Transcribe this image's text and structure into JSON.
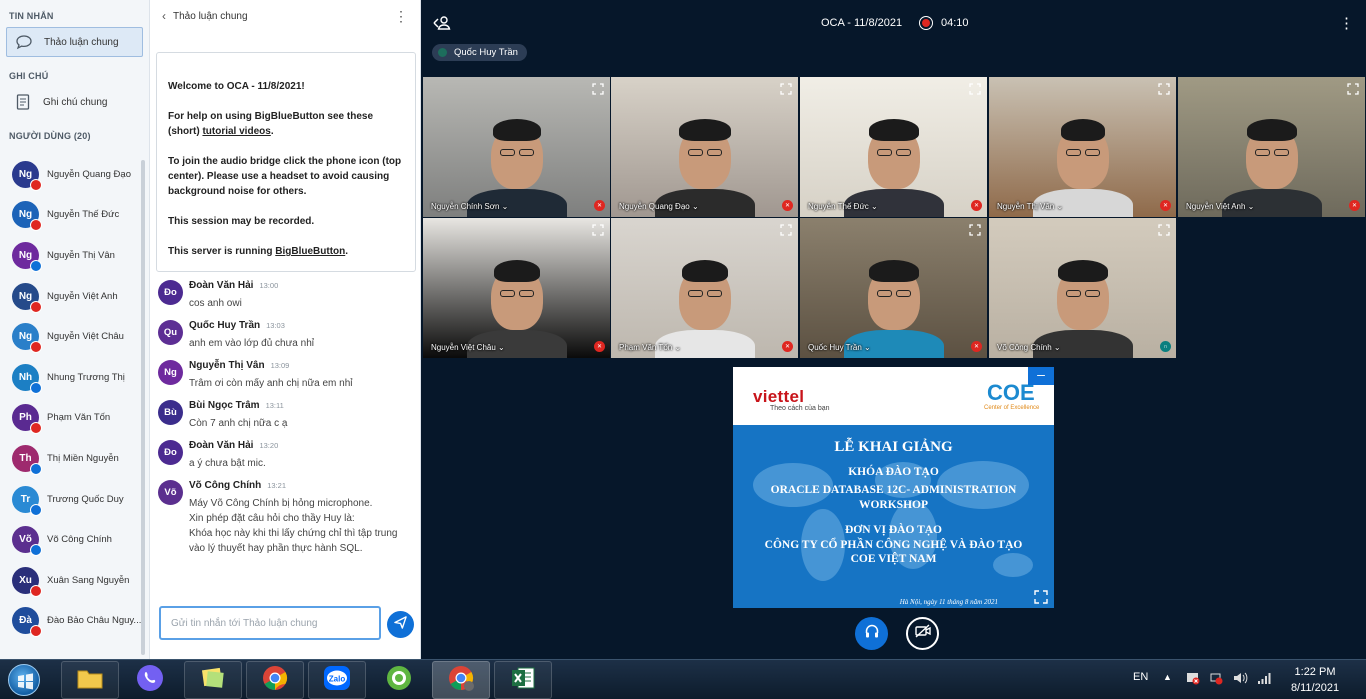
{
  "sidebar": {
    "messages_title": "TIN NHẮN",
    "public_chat": "Thảo luận chung",
    "notes_title": "GHI CHÚ",
    "shared_notes": "Ghi chú chung",
    "users_title": "NGƯỜI DÙNG (20)",
    "users": [
      {
        "initials": "Ng",
        "name": "Nguyễn Quang Đạo",
        "color": "#2a3a8e",
        "status": "muted"
      },
      {
        "initials": "Ng",
        "name": "Nguyễn Thế Đức",
        "color": "#1c63b8",
        "status": "muted"
      },
      {
        "initials": "Ng",
        "name": "Nguyễn Thị Vân",
        "color": "#6e2a9e",
        "status": "listen"
      },
      {
        "initials": "Ng",
        "name": "Nguyễn Việt Anh",
        "color": "#254a8a",
        "status": "muted"
      },
      {
        "initials": "Ng",
        "name": "Nguyễn Việt Châu",
        "color": "#2a7fc9",
        "status": "muted"
      },
      {
        "initials": "Nh",
        "name": "Nhung Trương Thị",
        "color": "#1c7fc4",
        "status": "listen"
      },
      {
        "initials": "Ph",
        "name": "Phạm Văn Tốn",
        "color": "#5a2a91",
        "status": "muted"
      },
      {
        "initials": "Th",
        "name": "Thị Miền Nguyễn",
        "color": "#9e2a6e",
        "status": "listen"
      },
      {
        "initials": "Tr",
        "name": "Trương Quốc Duy",
        "color": "#2a8ad4",
        "status": "listen"
      },
      {
        "initials": "Võ",
        "name": "Võ Công Chính",
        "color": "#5b2f8f",
        "status": "listen"
      },
      {
        "initials": "Xu",
        "name": "Xuân Sang Nguyễn",
        "color": "#2a2f7a",
        "status": "muted"
      },
      {
        "initials": "Đà",
        "name": "Đào Bảo Châu Nguy...",
        "color": "#1f4d9c",
        "status": "muted"
      }
    ]
  },
  "chat": {
    "title": "Thảo luận chung",
    "welcome": {
      "l1": "Welcome to OCA - 11/8/2021!",
      "l2a": "For help on using BigBlueButton see these (short) ",
      "l2link": "tutorial videos",
      "l2b": ".",
      "l3": "To join the audio bridge click the phone icon (top center). Please use a headset to avoid causing background noise for others.",
      "l4": "This session may be recorded.",
      "l5a": "This server is running ",
      "l5link": "BigBlueButton",
      "l5b": "."
    },
    "messages": [
      {
        "initials": "Đo",
        "color": "#4c2a91",
        "name": "Đoàn Văn Hải",
        "time": "13:00",
        "text": "cos anh owi"
      },
      {
        "initials": "Qu",
        "color": "#5d2e94",
        "name": "Quốc Huy Trần",
        "time": "13:03",
        "text": "anh em vào lớp đủ chưa nhỉ"
      },
      {
        "initials": "Ng",
        "color": "#6e2a9e",
        "name": "Nguyễn Thị Vân",
        "time": "13:09",
        "text": "Trâm ơi còn mấy anh chị nữa em nhỉ"
      },
      {
        "initials": "Bù",
        "color": "#3b2d8c",
        "name": "Bùi Ngọc Trâm",
        "time": "13:11",
        "text": "Còn 7 anh chị nữa c ạ"
      },
      {
        "initials": "Đo",
        "color": "#4c2a91",
        "name": "Đoàn Văn Hải",
        "time": "13:20",
        "text": "a ý chưa bật mic."
      },
      {
        "initials": "Võ",
        "color": "#5b2f8f",
        "name": "Võ Công Chính",
        "time": "13:21",
        "text": "Máy Võ Công Chính bị hỏng microphone.\nXin phép đặt câu hỏi cho thầy Huy là:\nKhóa học này khi thi lấy chứng chỉ thì tập trung vào lý thuyết hay phần thực hành SQL."
      }
    ],
    "input_placeholder": "Gửi tin nhắn tới Thảo luận chung"
  },
  "meeting": {
    "title": "OCA - 11/8/2021",
    "recording_time": "04:10",
    "talker": "Quốc Huy Trần",
    "videos": [
      {
        "name": "Nguyễn Chính Sơn",
        "status": "muted"
      },
      {
        "name": "Nguyễn Quang Đạo",
        "status": "muted"
      },
      {
        "name": "Nguyễn Thế Đức",
        "status": "muted"
      },
      {
        "name": "Nguyễn Thị Vân",
        "status": "muted"
      },
      {
        "name": "Nguyễn Việt Anh",
        "status": "muted"
      },
      {
        "name": "Nguyễn Việt Châu",
        "status": "muted"
      },
      {
        "name": "Phạm Văn Tốn",
        "status": "muted"
      },
      {
        "name": "Quốc Huy Trần",
        "status": "muted"
      },
      {
        "name": "Võ Công Chính",
        "status": "listen"
      }
    ]
  },
  "slide": {
    "brand": "viettel",
    "tagline": "Theo cách của bạn",
    "coe": "COE",
    "coe_sub": "Center of Excellence",
    "title": "LỄ KHAI GIẢNG",
    "l1": "KHÓA ĐÀO TẠO",
    "l2": "ORACLE DATABASE 12C- ADMINISTRATION",
    "l3": "WORKSHOP",
    "l4": "ĐƠN VỊ ĐÀO TẠO",
    "l5": "CÔNG TY CỔ PHẦN CÔNG NGHỆ VÀ ĐÀO TẠO",
    "l6": "COE VIỆT NAM",
    "date": "Hà Nội, ngày 11 tháng 8 năm 2021"
  },
  "taskbar": {
    "lang": "EN",
    "time": "1:22 PM",
    "date": "8/11/2021",
    "apps": [
      "explorer",
      "viber",
      "notes",
      "chrome",
      "zalo",
      "coccoc",
      "chrome-active",
      "excel"
    ]
  }
}
